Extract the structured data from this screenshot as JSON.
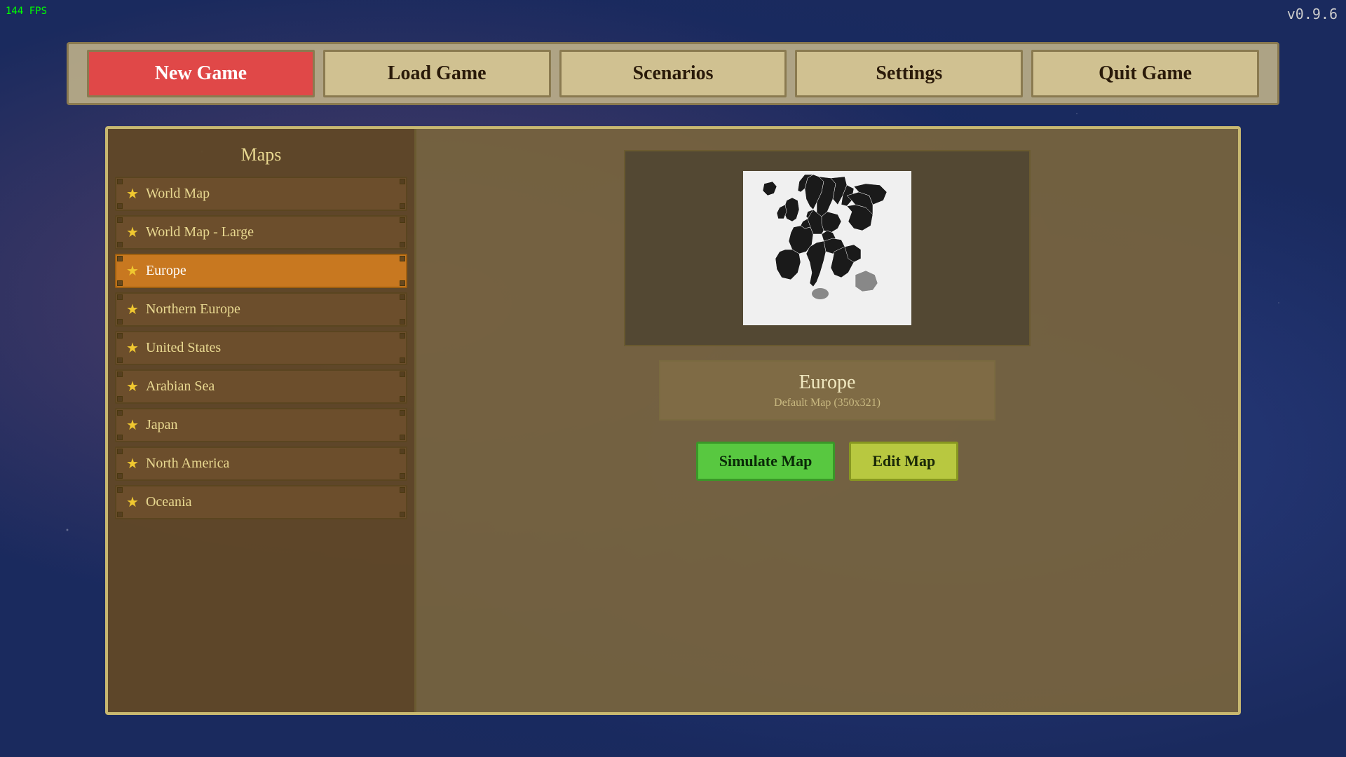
{
  "fps": "144 FPS",
  "version": "v0.9.6",
  "nav": {
    "new_game": "New Game",
    "load_game": "Load Game",
    "scenarios": "Scenarios",
    "settings": "Settings",
    "quit_game": "Quit Game"
  },
  "maps_panel": {
    "title": "Maps",
    "items": [
      {
        "id": "world-map",
        "label": "World Map",
        "active": false
      },
      {
        "id": "world-map-large",
        "label": "World Map - Large",
        "active": false
      },
      {
        "id": "europe",
        "label": "Europe",
        "active": true
      },
      {
        "id": "northern-europe",
        "label": "Northern Europe",
        "active": false
      },
      {
        "id": "united-states",
        "label": "United States",
        "active": false
      },
      {
        "id": "arabian-sea",
        "label": "Arabian Sea",
        "active": false
      },
      {
        "id": "japan",
        "label": "Japan",
        "active": false
      },
      {
        "id": "north-america",
        "label": "North America",
        "active": false
      },
      {
        "id": "oceania",
        "label": "Oceania",
        "active": false
      }
    ]
  },
  "detail": {
    "map_name": "Europe",
    "map_sub": "Default Map (350x321)",
    "simulate_btn": "Simulate Map",
    "edit_btn": "Edit Map"
  }
}
